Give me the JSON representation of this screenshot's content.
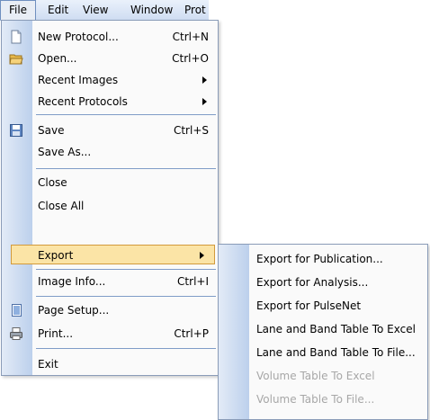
{
  "menubar": {
    "items": [
      {
        "label": "File"
      },
      {
        "label": "Edit"
      },
      {
        "label": "View"
      },
      {
        "label": "Window"
      },
      {
        "label": "Prot"
      }
    ]
  },
  "file_menu": {
    "items": [
      {
        "label": "New Protocol...",
        "shortcut": "Ctrl+N",
        "icon": "new-document-icon"
      },
      {
        "label": "Open...",
        "shortcut": "Ctrl+O",
        "icon": "open-folder-icon"
      },
      {
        "label": "Recent Images",
        "submenu": true
      },
      {
        "label": "Recent Protocols",
        "submenu": true
      },
      {
        "label": "Save",
        "shortcut": "Ctrl+S",
        "icon": "floppy-disk-icon"
      },
      {
        "label": "Save As..."
      },
      {
        "label": "Close"
      },
      {
        "label": "Close All"
      },
      {
        "label": "Export",
        "submenu": true,
        "highlighted": true
      },
      {
        "label": "Image Info...",
        "shortcut": "Ctrl+I"
      },
      {
        "label": "Page Setup...",
        "icon": "page-setup-icon"
      },
      {
        "label": "Print...",
        "shortcut": "Ctrl+P",
        "icon": "printer-icon"
      },
      {
        "label": "Exit"
      }
    ]
  },
  "export_submenu": {
    "items": [
      {
        "label": "Export for Publication...",
        "enabled": true
      },
      {
        "label": "Export for Analysis...",
        "enabled": true
      },
      {
        "label": "Export for PulseNet",
        "enabled": true
      },
      {
        "label": "Lane and Band Table To Excel",
        "enabled": true
      },
      {
        "label": "Lane and Band Table To File...",
        "enabled": true
      },
      {
        "label": "Volume Table To Excel",
        "enabled": false
      },
      {
        "label": "Volume Table To File...",
        "enabled": false
      }
    ]
  },
  "colors": {
    "highlight_fill": "#fbe4a6",
    "highlight_border": "#d29a3c",
    "disabled_text": "#a7a7a7",
    "gutter": "#bcd0ec"
  }
}
